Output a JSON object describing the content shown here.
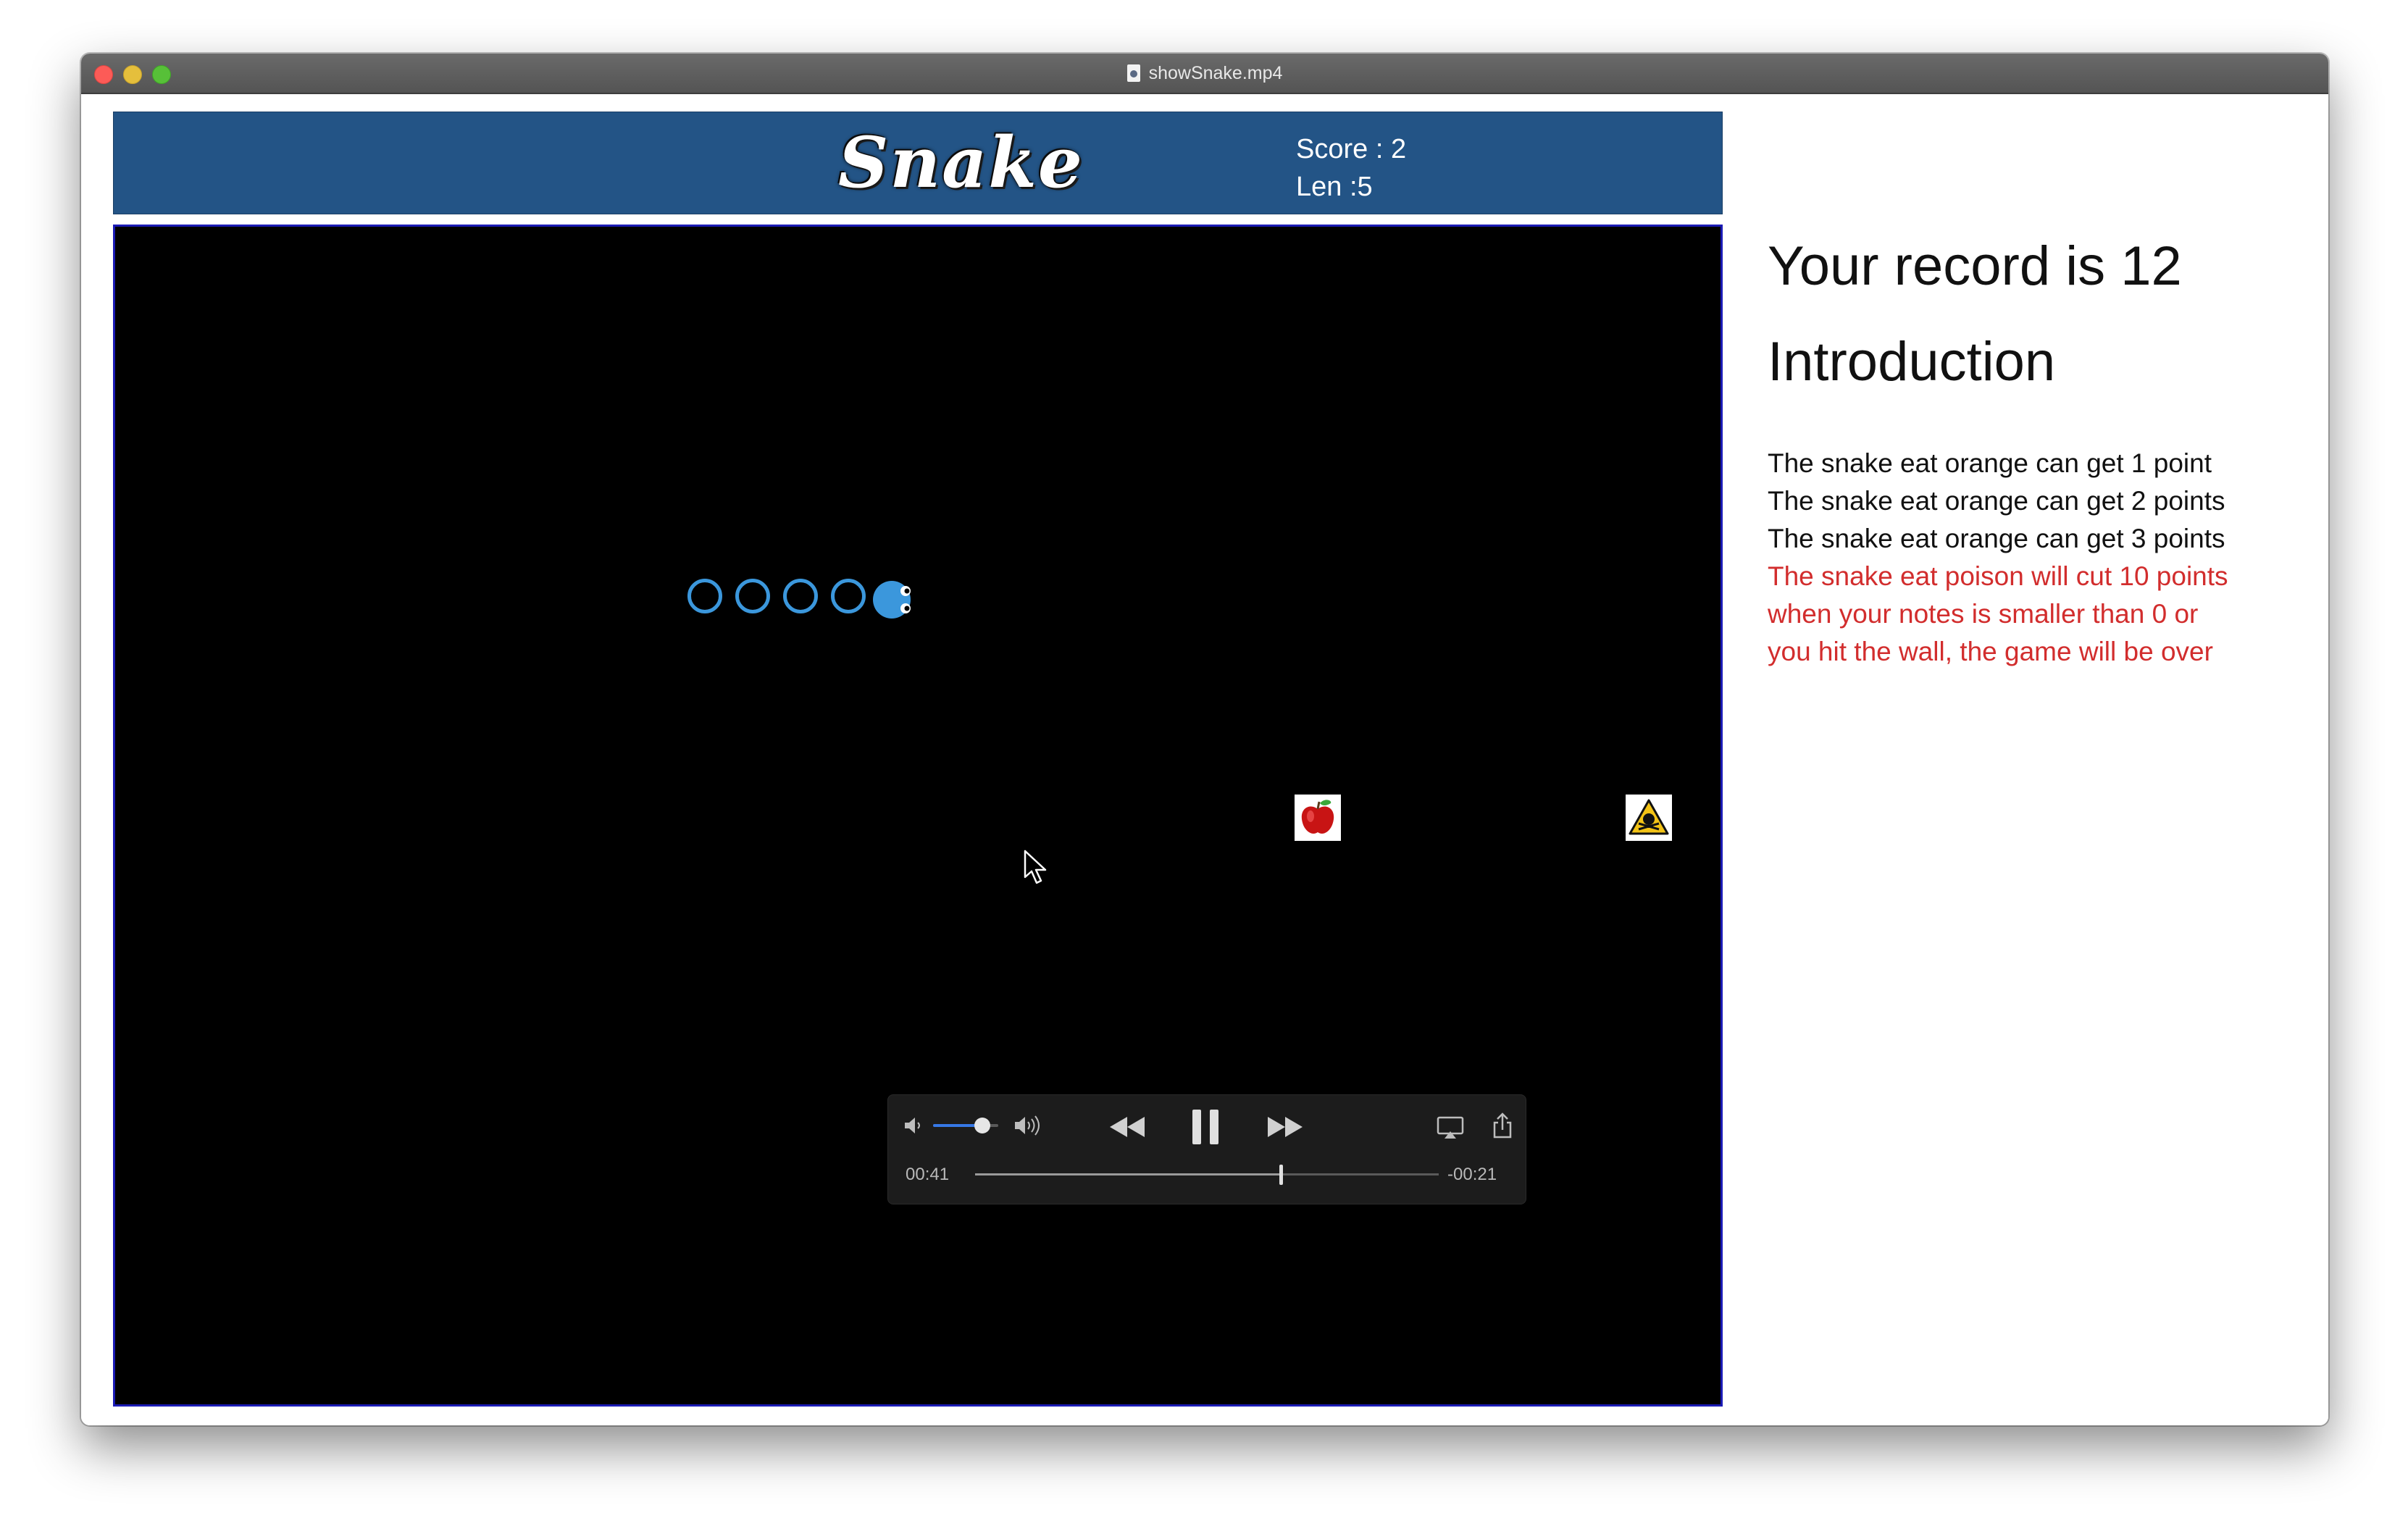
{
  "window": {
    "title": "showSnake.mp4"
  },
  "header": {
    "logo": "Snake",
    "score_label": "Score : 2",
    "len_label": "Len :5"
  },
  "board": {
    "snake_body_segments": 4,
    "items": [
      {
        "name": "apple",
        "icon": "apple-icon"
      },
      {
        "name": "poison",
        "icon": "poison-warning-icon"
      }
    ]
  },
  "player": {
    "elapsed": "00:41",
    "remaining": "-00:21",
    "progress_fraction": 0.66,
    "volume_fraction": 0.75
  },
  "sidebar": {
    "record": "Your record is 12",
    "intro_title": "Introduction",
    "rules": [
      "The snake eat orange can get 1 point",
      "The snake eat orange can get 2 points",
      "The snake eat orange can get 3 points",
      "The snake eat poison will cut 10 points",
      "when your notes is smaller than 0 or",
      "you hit the wall, the game will be over"
    ]
  },
  "colors": {
    "header_bg": "#235486",
    "board_bg": "#000000",
    "snake": "#3b97dc",
    "warning_text": "#d22d2d"
  }
}
